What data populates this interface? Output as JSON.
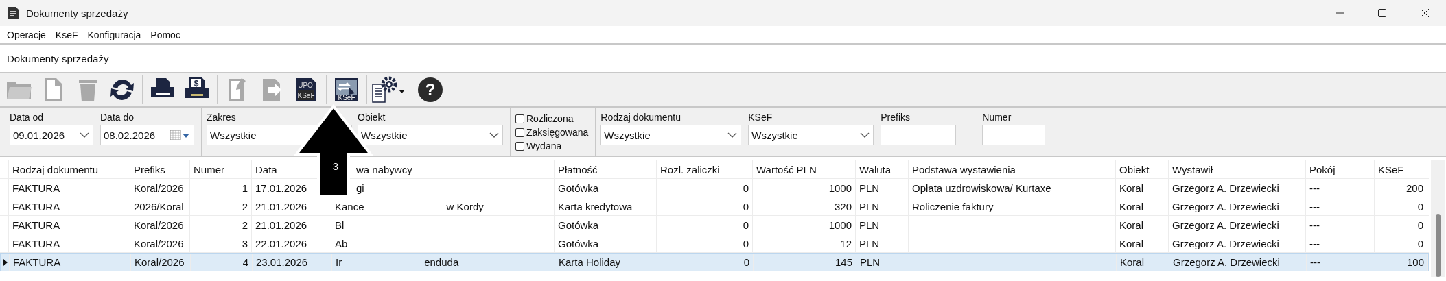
{
  "window": {
    "title": "Dokumenty sprzedaży"
  },
  "menu": [
    {
      "label": "Operacje"
    },
    {
      "label": "KseF"
    },
    {
      "label": "Konfiguracja"
    },
    {
      "label": "Pomoc"
    }
  ],
  "document_header": "Dokumenty sprzedaży",
  "toolbar": {
    "items": [
      {
        "kind": "folder",
        "disabled": true
      },
      {
        "kind": "document",
        "disabled": true
      },
      {
        "kind": "trash",
        "disabled": true
      },
      {
        "kind": "refresh",
        "disabled": false
      },
      {
        "kind": "separator"
      },
      {
        "kind": "printer",
        "disabled": false
      },
      {
        "kind": "printer-dollar",
        "disabled": false,
        "icon_text": [
          "$"
        ]
      },
      {
        "kind": "separator"
      },
      {
        "kind": "document-edit",
        "disabled": true
      },
      {
        "kind": "document-export",
        "disabled": true
      },
      {
        "kind": "upo-ksef",
        "disabled": false,
        "icon_text": [
          "UPO",
          "KSeF"
        ]
      },
      {
        "kind": "separator"
      },
      {
        "kind": "ksef-send",
        "disabled": false,
        "icon_text": [
          "KSeF"
        ]
      },
      {
        "kind": "separator"
      },
      {
        "kind": "document-gear",
        "disabled": false
      },
      {
        "kind": "separator"
      },
      {
        "kind": "help",
        "disabled": false,
        "icon_text": [
          "?"
        ]
      }
    ]
  },
  "filters": {
    "groups": [
      {
        "fields": [
          {
            "kind": "date-dropdown",
            "label": "Data od",
            "value": "09.01.2026"
          },
          {
            "kind": "date-calendar",
            "label": "Data do",
            "value": "08.02.2026"
          }
        ]
      },
      {
        "fields": [
          {
            "kind": "combo-covered",
            "label": "Zakres",
            "value": "Wszystkie"
          },
          {
            "kind": "combo",
            "label": "Obiekt",
            "value": "Wszystkie"
          }
        ]
      },
      {
        "fields": [
          {
            "kind": "checkboxes",
            "items": [
              {
                "label": "Rozliczona",
                "checked": false
              },
              {
                "label": "Zaksięgowana",
                "checked": false
              },
              {
                "label": "Wydana",
                "checked": false
              }
            ]
          }
        ]
      },
      {
        "fields": [
          {
            "kind": "combo",
            "label": "Rodzaj dokumentu",
            "value": "Wszystkie"
          },
          {
            "kind": "combo",
            "label": "KSeF",
            "value": "Wszystkie"
          },
          {
            "kind": "text",
            "label": "Prefiks"
          },
          {
            "kind": "text",
            "label": "Numer"
          }
        ]
      }
    ]
  },
  "table": {
    "columns": [
      {
        "label": "Rodzaj dokumentu",
        "kind": "text"
      },
      {
        "label": "Prefiks",
        "kind": "text"
      },
      {
        "label": "Numer",
        "kind": "number"
      },
      {
        "label": "Data",
        "kind": "text"
      },
      {
        "label": "wa nabywcy",
        "kind": "fragments"
      },
      {
        "label": "Płatność",
        "kind": "text"
      },
      {
        "label": "Rozl. zaliczki",
        "kind": "number"
      },
      {
        "label": "Wartość PLN",
        "kind": "number"
      },
      {
        "label": "Waluta",
        "kind": "text"
      },
      {
        "label": "Podstawa wystawienia",
        "kind": "text"
      },
      {
        "label": "Obiekt",
        "kind": "text"
      },
      {
        "label": "Wystawił",
        "kind": "text"
      },
      {
        "label": "Pokój",
        "kind": "text"
      },
      {
        "label": "KSeF",
        "kind": "number"
      }
    ],
    "rows": [
      {
        "selected": false,
        "cells": [
          "FAKTURA",
          "Koral/2026",
          "1",
          "17.01.2026",
          [
            "gi"
          ],
          "Gotówka",
          "0",
          "1000",
          "PLN",
          "Opłata uzdrowiskowa/ Kurtaxe",
          "Koral",
          "Grzegorz A. Drzewiecki",
          "---",
          "200"
        ]
      },
      {
        "selected": false,
        "cells": [
          "FAKTURA",
          "2026/Koral",
          "2",
          "21.01.2026",
          [
            "Kance",
            "w Kordy"
          ],
          "Karta kredytowa",
          "0",
          "320",
          "PLN",
          "Roliczenie faktury",
          "Koral",
          "Grzegorz A. Drzewiecki",
          "---",
          "0"
        ]
      },
      {
        "selected": false,
        "cells": [
          "FAKTURA",
          "Koral/2026",
          "2",
          "21.01.2026",
          [
            "Bl"
          ],
          "Gotówka",
          "0",
          "1000",
          "PLN",
          "",
          "Koral",
          "Grzegorz A. Drzewiecki",
          "---",
          "0"
        ]
      },
      {
        "selected": false,
        "cells": [
          "FAKTURA",
          "Koral/2026",
          "3",
          "22.01.2026",
          [
            "Ab"
          ],
          "Gotówka",
          "0",
          "12",
          "PLN",
          "",
          "Koral",
          "Grzegorz A. Drzewiecki",
          "---",
          "0"
        ]
      },
      {
        "selected": true,
        "cells": [
          "FAKTURA",
          "Koral/2026",
          "4",
          "23.01.2026",
          [
            "Ir",
            "enduda"
          ],
          "Karta Holiday",
          "0",
          "145",
          "PLN",
          "",
          "Koral",
          "Grzegorz A. Drzewiecki",
          "---",
          "100"
        ]
      }
    ]
  },
  "callout": {
    "kind": "arrow-up",
    "label": "3"
  }
}
